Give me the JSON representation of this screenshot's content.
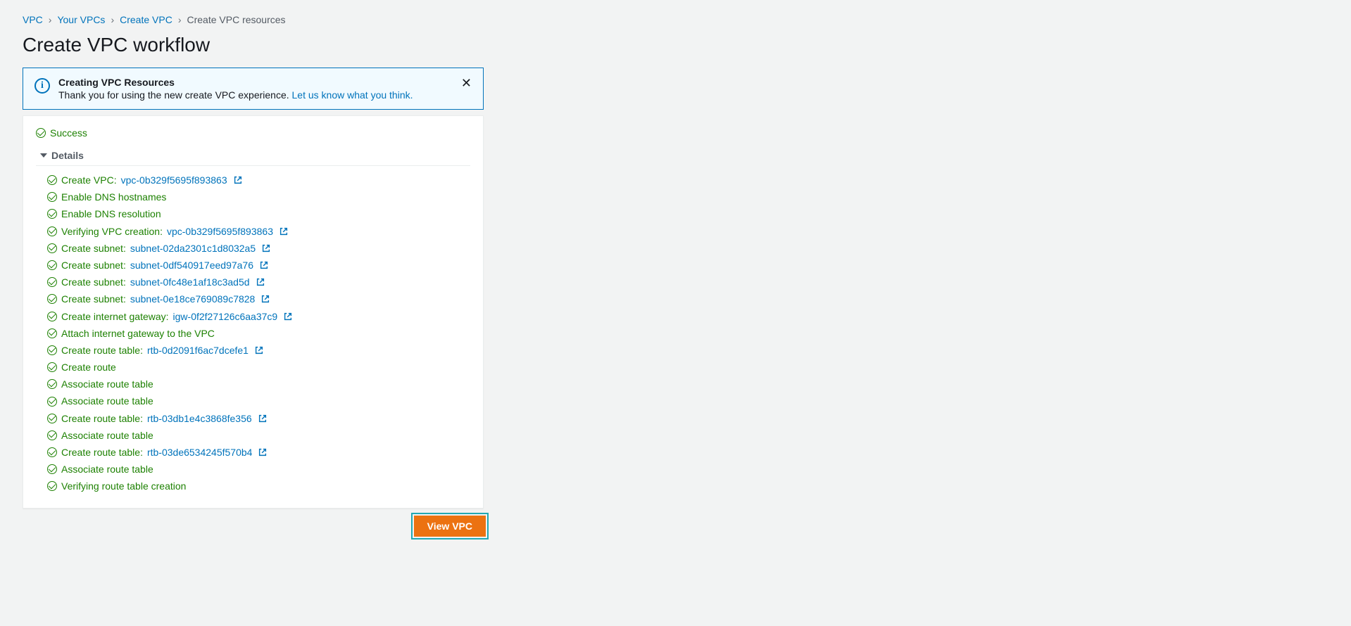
{
  "breadcrumb": {
    "items": [
      {
        "label": "VPC",
        "link": true
      },
      {
        "label": "Your VPCs",
        "link": true
      },
      {
        "label": "Create VPC",
        "link": true
      },
      {
        "label": "Create VPC resources",
        "link": false
      }
    ]
  },
  "page_title": "Create VPC workflow",
  "info": {
    "title": "Creating VPC Resources",
    "desc": "Thank you for using the new create VPC experience. ",
    "feedback_link": "Let us know what you think."
  },
  "status": {
    "label": "Success"
  },
  "details_label": "Details",
  "steps": [
    {
      "prefix": "Create VPC: ",
      "link": "vpc-0b329f5695f893863",
      "ext": true
    },
    {
      "prefix": "Enable DNS hostnames",
      "link": "",
      "ext": false
    },
    {
      "prefix": "Enable DNS resolution",
      "link": "",
      "ext": false
    },
    {
      "prefix": "Verifying VPC creation: ",
      "link": "vpc-0b329f5695f893863",
      "ext": true
    },
    {
      "prefix": "Create subnet: ",
      "link": "subnet-02da2301c1d8032a5",
      "ext": true
    },
    {
      "prefix": "Create subnet: ",
      "link": "subnet-0df540917eed97a76",
      "ext": true
    },
    {
      "prefix": "Create subnet: ",
      "link": "subnet-0fc48e1af18c3ad5d",
      "ext": true
    },
    {
      "prefix": "Create subnet: ",
      "link": "subnet-0e18ce769089c7828",
      "ext": true
    },
    {
      "prefix": "Create internet gateway: ",
      "link": "igw-0f2f27126c6aa37c9",
      "ext": true
    },
    {
      "prefix": "Attach internet gateway to the VPC",
      "link": "",
      "ext": false
    },
    {
      "prefix": "Create route table: ",
      "link": "rtb-0d2091f6ac7dcefe1",
      "ext": true
    },
    {
      "prefix": "Create route",
      "link": "",
      "ext": false
    },
    {
      "prefix": "Associate route table",
      "link": "",
      "ext": false
    },
    {
      "prefix": "Associate route table",
      "link": "",
      "ext": false
    },
    {
      "prefix": "Create route table: ",
      "link": "rtb-03db1e4c3868fe356",
      "ext": true
    },
    {
      "prefix": "Associate route table",
      "link": "",
      "ext": false
    },
    {
      "prefix": "Create route table: ",
      "link": "rtb-03de6534245f570b4",
      "ext": true
    },
    {
      "prefix": "Associate route table",
      "link": "",
      "ext": false
    },
    {
      "prefix": "Verifying route table creation",
      "link": "",
      "ext": false
    }
  ],
  "view_button": "View VPC"
}
